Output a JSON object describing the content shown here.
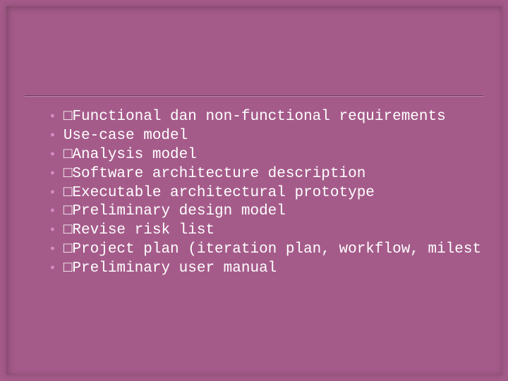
{
  "slide": {
    "marker_glyph": "□",
    "items": [
      {
        "has_marker": true,
        "text": " Functional dan non-functional requirements"
      },
      {
        "has_marker": false,
        "text": " Use-case model"
      },
      {
        "has_marker": true,
        "text": " Analysis model"
      },
      {
        "has_marker": true,
        "text": " Software architecture description"
      },
      {
        "has_marker": true,
        "text": " Executable architectural prototype"
      },
      {
        "has_marker": true,
        "text": " Preliminary design model"
      },
      {
        "has_marker": true,
        "text": " Revise risk list"
      },
      {
        "has_marker": true,
        "text": " Project plan (iteration plan, workflow, milest"
      },
      {
        "has_marker": true,
        "text": " Preliminary user manual"
      }
    ]
  },
  "colors": {
    "background": "#a55b8a",
    "bullet": "#d889c2",
    "text": "#ffffff"
  }
}
